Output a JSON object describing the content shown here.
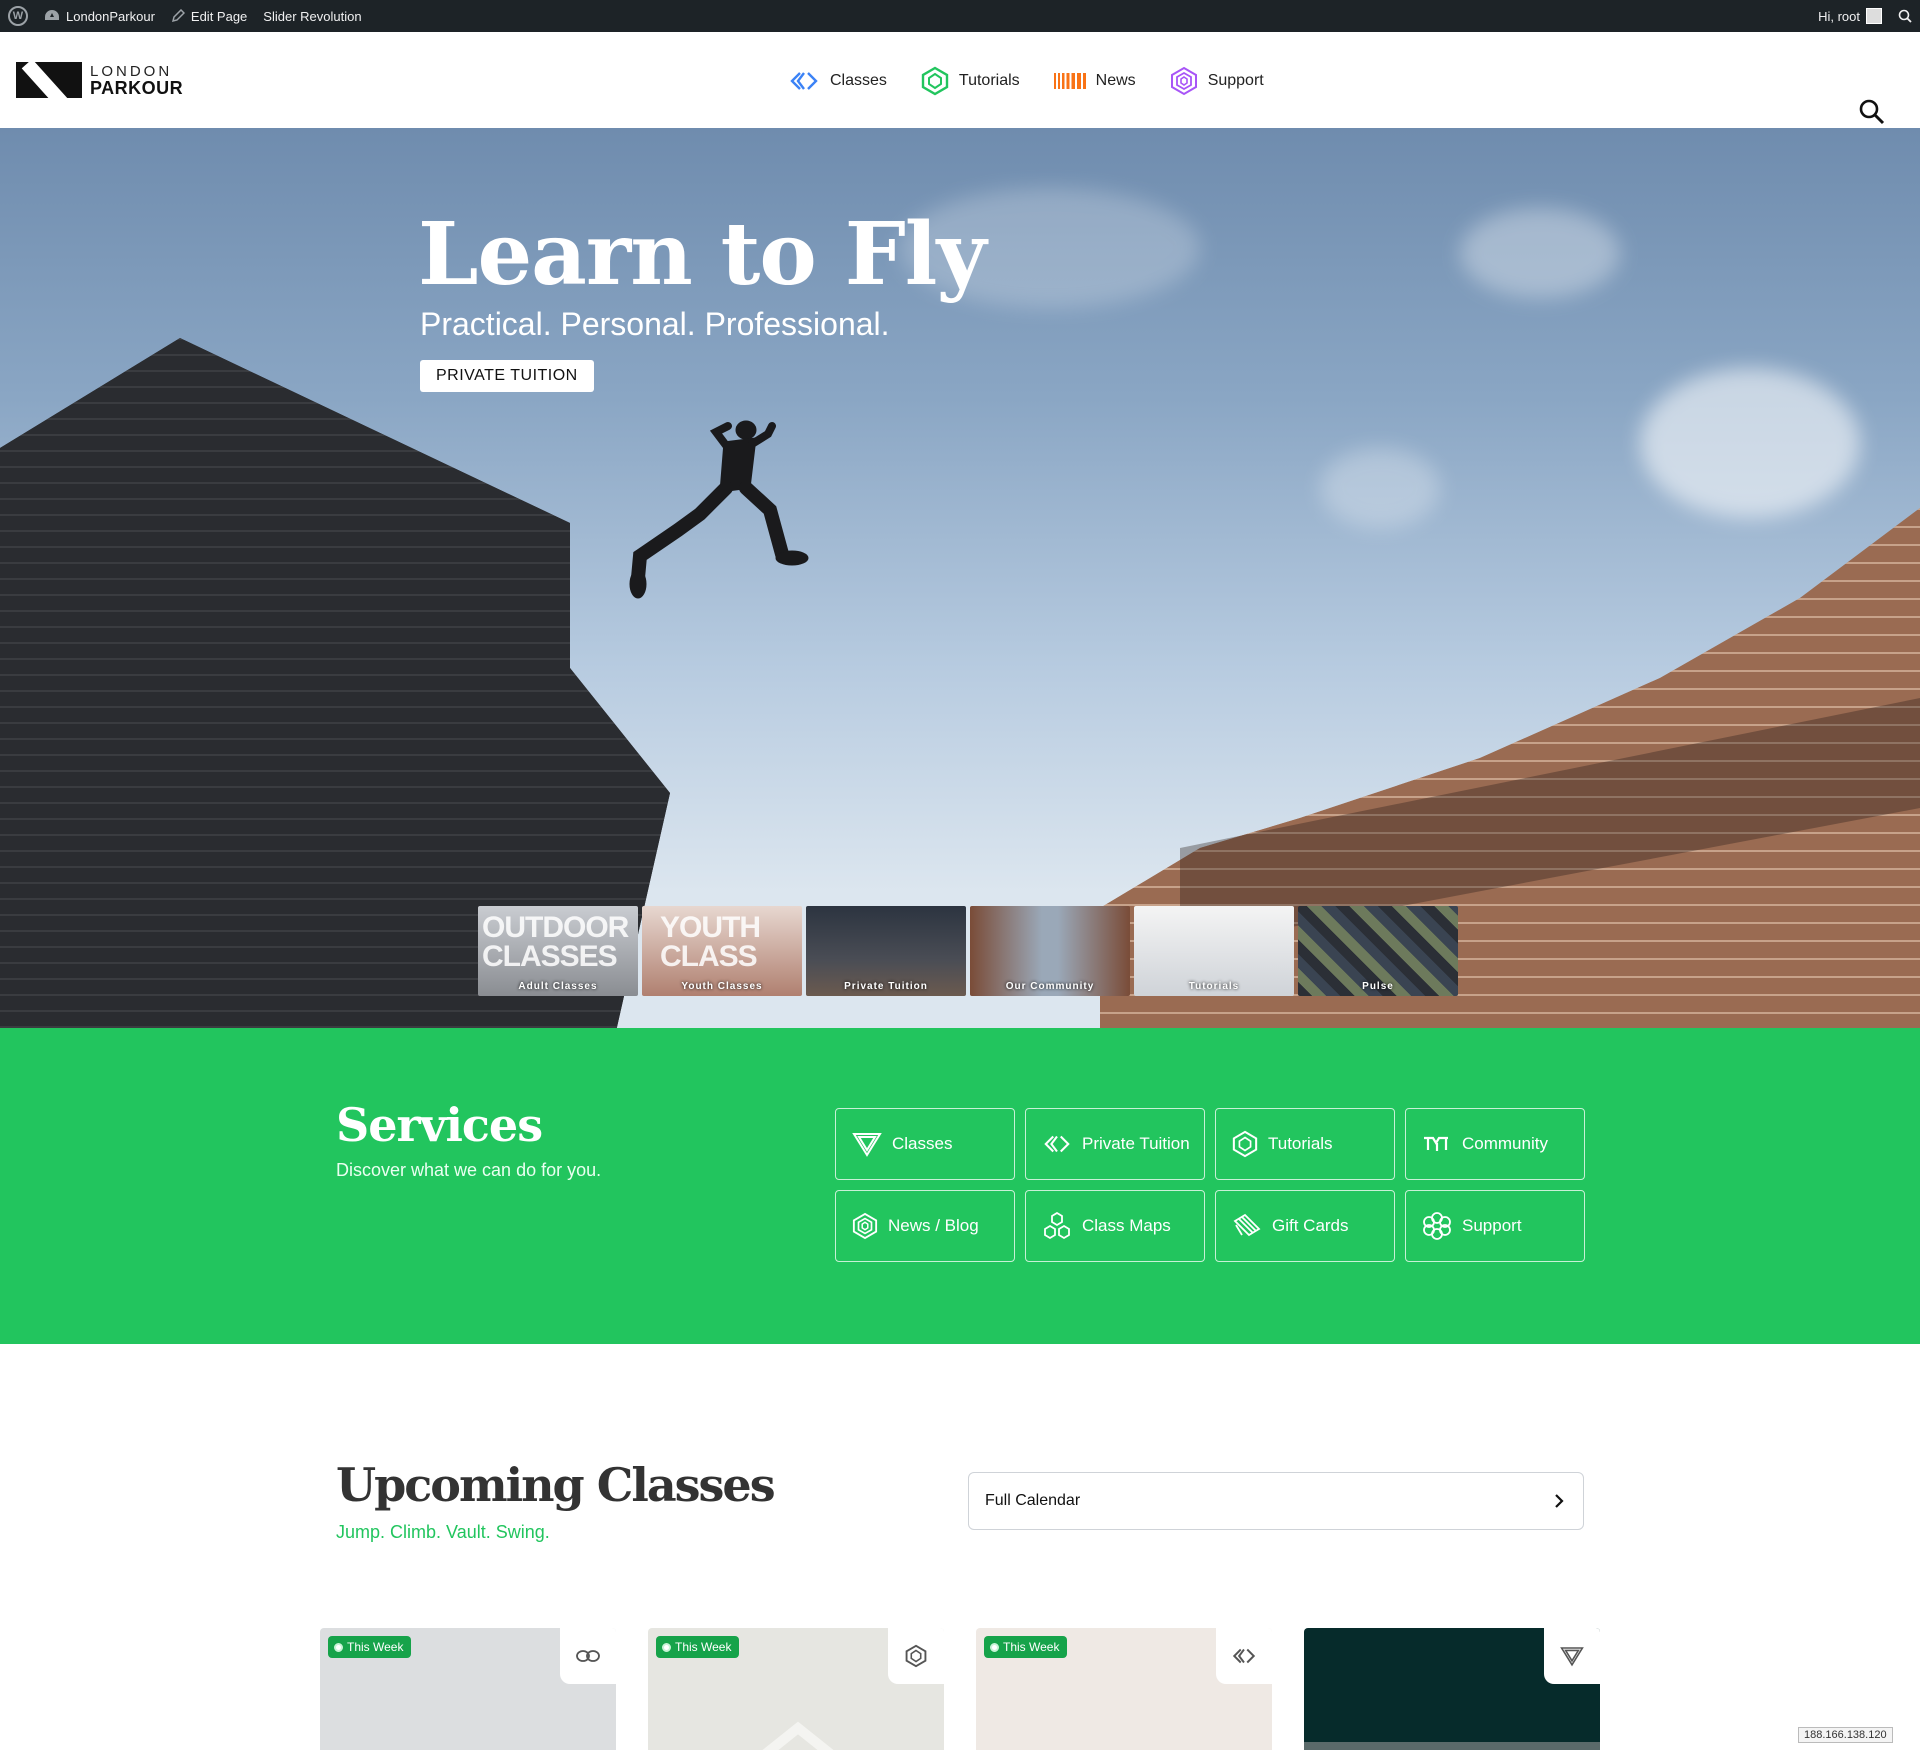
{
  "adminbar": {
    "site_name": "LondonParkour",
    "edit_page": "Edit Page",
    "slider": "Slider Revolution",
    "greeting": "Hi, root"
  },
  "header": {
    "logo_line1": "LONDON",
    "logo_line2": "PARKOUR",
    "nav": [
      {
        "label": "Classes",
        "icon": "chevrons-icon",
        "color": "#3b82f6"
      },
      {
        "label": "Tutorials",
        "icon": "hexagon-icon",
        "color": "#22c55e"
      },
      {
        "label": "News",
        "icon": "bars-icon",
        "color": "#f97316"
      },
      {
        "label": "Support",
        "icon": "hexagon-rings-icon",
        "color": "#a855f7"
      }
    ]
  },
  "hero": {
    "title": "Learn to Fly",
    "subtitle": "Practical. Personal. Professional.",
    "button": "PRIVATE TUITION",
    "thumbs": [
      {
        "big": "OUTDOOR CLASSES",
        "caption": "Adult Classes"
      },
      {
        "big": "YOUTH CLASS",
        "caption": "Youth Classes"
      },
      {
        "big": "",
        "caption": "Private Tuition"
      },
      {
        "big": "",
        "caption": "Our Community"
      },
      {
        "big": "",
        "caption": "Tutorials"
      },
      {
        "big": "",
        "caption": "Pulse"
      }
    ]
  },
  "services": {
    "title": "Services",
    "subtitle": "Discover what we can do for you.",
    "buttons": [
      {
        "label": "Classes",
        "icon": "triangle-icon"
      },
      {
        "label": "Private Tuition",
        "icon": "chevrons-icon"
      },
      {
        "label": "Tutorials",
        "icon": "hexagon-icon"
      },
      {
        "label": "Community",
        "icon": "community-icon"
      },
      {
        "label": "News / Blog",
        "icon": "hexagon-rings-icon"
      },
      {
        "label": "Class Maps",
        "icon": "hex-cluster-icon"
      },
      {
        "label": "Gift Cards",
        "icon": "gift-card-icon"
      },
      {
        "label": "Support",
        "icon": "flower-icon"
      }
    ]
  },
  "upcoming": {
    "title": "Upcoming Classes",
    "subtitle": "Jump. Climb. Vault. Swing.",
    "calendar_label": "Full Calendar",
    "cards": [
      {
        "badge": "This Week",
        "icon": "links-icon",
        "bg": "#dcdee0"
      },
      {
        "badge": "This Week",
        "icon": "hexagon-icon",
        "bg": "#e6e6e1"
      },
      {
        "badge": "This Week",
        "icon": "chevrons-icon",
        "bg": "#efe9e4"
      },
      {
        "badge": "",
        "icon": "triangle-icon",
        "bg": "#062b2b"
      }
    ]
  },
  "footer_ip": "188.166.138.120",
  "colors": {
    "accent_green": "#22c55e",
    "badge_green": "#16a34a",
    "adminbar": "#1d2327"
  }
}
